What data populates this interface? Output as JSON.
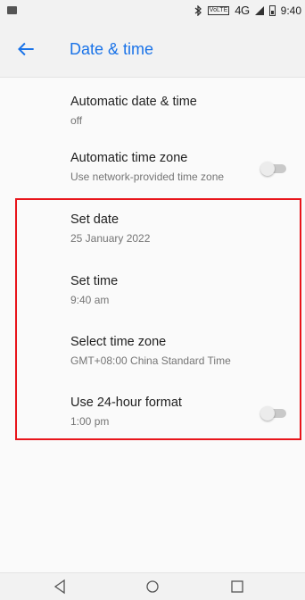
{
  "status_bar": {
    "network": "4G",
    "volte_label": "VoLTE",
    "time": "9:40"
  },
  "app_bar": {
    "title": "Date & time"
  },
  "settings": [
    {
      "title": "Automatic date & time",
      "summary": "off"
    },
    {
      "title": "Automatic time zone",
      "summary": "Use network-provided time zone",
      "toggle": "off"
    },
    {
      "title": "Set date",
      "summary": "25 January 2022"
    },
    {
      "title": "Set time",
      "summary": "9:40 am"
    },
    {
      "title": "Select time zone",
      "summary": "GMT+08:00 China Standard Time"
    },
    {
      "title": "Use 24-hour format",
      "summary": "1:00 pm",
      "toggle": "off"
    }
  ],
  "colors": {
    "accent": "#1a73e8",
    "highlight": "#e8151b"
  },
  "icons": {
    "back": "arrow-left-icon",
    "nav_back": "triangle-back-icon",
    "nav_home": "circle-home-icon",
    "nav_recents": "square-recents-icon"
  }
}
